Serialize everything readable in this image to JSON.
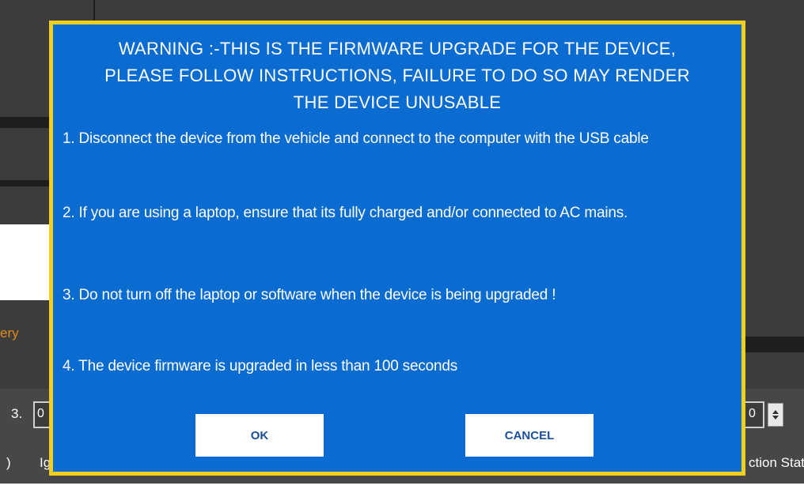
{
  "background": {
    "side_text_partial": "ery",
    "row_number_partial": "3.",
    "field_partial": "0",
    "field_partial_right": "0",
    "left_label_partial": ")",
    "second_label_partial": "Ig",
    "status_label_partial": "ction Stat"
  },
  "dialog": {
    "warning": "WARNING :-THIS IS THE FIRMWARE UPGRADE FOR THE DEVICE, PLEASE FOLLOW INSTRUCTIONS, FAILURE TO DO SO MAY RENDER THE DEVICE UNUSABLE",
    "instructions": [
      "1. Disconnect the device from the vehicle and connect to the computer with the USB cable",
      "2. If you are using a laptop, ensure that its fully charged and/or connected to AC mains.",
      "3. Do not turn off the laptop or software when the device is being upgraded !",
      "4. The device firmware is upgraded in less than 100 seconds"
    ],
    "ok_label": "OK",
    "cancel_label": "CANCEL"
  },
  "colors": {
    "dialog_background": "#0a6bd0",
    "dialog_border": "#f2cf1f",
    "app_background": "#3c3c3c",
    "accent_orange": "#e08a1b"
  }
}
